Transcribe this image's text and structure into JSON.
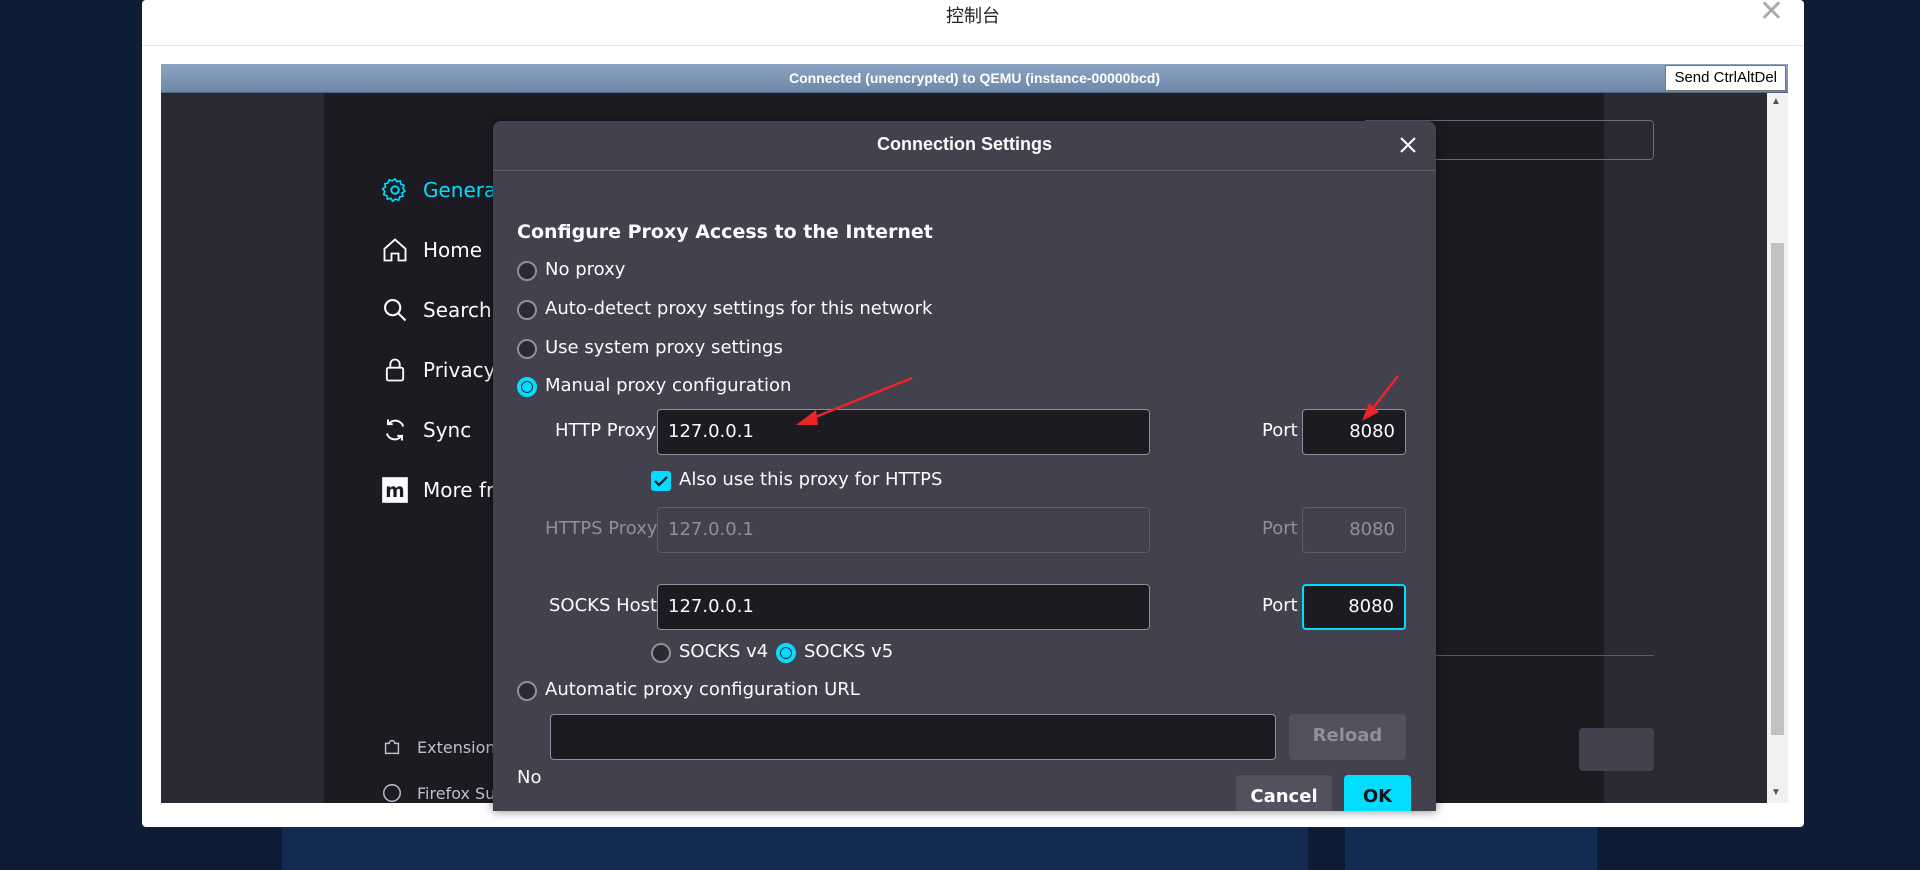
{
  "console": {
    "title": "控制台",
    "close": "✕",
    "vnc_status": "Connected (unencrypted) to QEMU (instance-00000bcd)",
    "send_cad": "Send CtrlAltDel"
  },
  "sidebar": {
    "items": [
      {
        "label": "General",
        "icon": "gear-icon"
      },
      {
        "label": "Home",
        "icon": "home-icon"
      },
      {
        "label": "Search",
        "icon": "search-icon"
      },
      {
        "label": "Privacy",
        "icon": "lock-icon"
      },
      {
        "label": "Sync",
        "icon": "sync-icon"
      },
      {
        "label": "More fro",
        "icon": "mozilla-icon"
      }
    ],
    "footer": [
      {
        "label": "Extension",
        "icon": "puzzle-icon"
      },
      {
        "label": "Firefox Su",
        "icon": "help-icon"
      }
    ]
  },
  "dialog": {
    "title": "Connection Settings",
    "heading": "Configure Proxy Access to the Internet",
    "options": {
      "no_proxy": "No proxy",
      "auto_detect": "Auto-detect proxy settings for this network",
      "system": "Use system proxy settings",
      "manual": "Manual proxy configuration",
      "auto_url": "Automatic proxy configuration URL"
    },
    "selected": "manual",
    "http_proxy": {
      "label": "HTTP Proxy",
      "value": "127.0.0.1",
      "port_label": "Port",
      "port": "8080"
    },
    "also_https": {
      "label": "Also use this proxy for HTTPS",
      "checked": true
    },
    "https_proxy": {
      "label": "HTTPS Proxy",
      "value": "127.0.0.1",
      "port_label": "Port",
      "port": "8080"
    },
    "socks": {
      "label": "SOCKS Host",
      "value": "127.0.0.1",
      "port_label": "Port",
      "port": "8080",
      "v4": "SOCKS v4",
      "v5": "SOCKS v5",
      "version": "v5"
    },
    "auto_url_value": "",
    "reload": "Reload",
    "truncated_text": "No",
    "cancel": "Cancel",
    "ok": "OK"
  },
  "colors": {
    "accent": "#00ddff",
    "annotation": "#e8262a"
  }
}
